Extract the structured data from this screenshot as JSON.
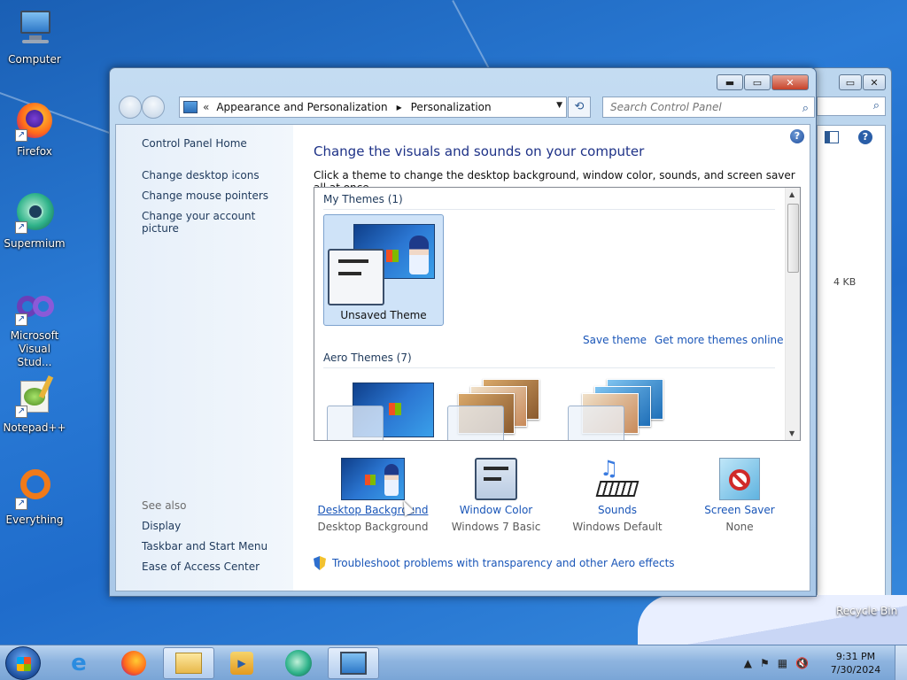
{
  "desktop": {
    "icons": [
      {
        "label": "Computer"
      },
      {
        "label": "Firefox"
      },
      {
        "label": "Supermium"
      },
      {
        "label": "Microsoft Visual Stud..."
      },
      {
        "label": "Notepad++"
      },
      {
        "label": "Everything"
      }
    ],
    "recycle_label": "Recycle Bin",
    "background_window_size": "4 KB"
  },
  "window": {
    "breadcrumb_prefix": "«",
    "breadcrumb": [
      "Appearance and Personalization",
      "Personalization"
    ],
    "search_placeholder": "Search Control Panel",
    "left_pane": {
      "home": "Control Panel Home",
      "links": [
        "Change desktop icons",
        "Change mouse pointers",
        "Change your account picture"
      ],
      "see_also_heading": "See also",
      "see_also": [
        "Display",
        "Taskbar and Start Menu",
        "Ease of Access Center"
      ]
    },
    "title": "Change the visuals and sounds on your computer",
    "subtitle": "Click a theme to change the desktop background, window color, sounds, and screen saver all at once.",
    "my_themes_heading": "My Themes (1)",
    "unsaved_theme_label": "Unsaved Theme",
    "save_theme": "Save theme",
    "get_more_themes": "Get more themes online",
    "aero_themes_heading": "Aero Themes (7)",
    "bottom": [
      {
        "label": "Desktop Background",
        "value": "Desktop Background",
        "icon": "wallpaper-icon"
      },
      {
        "label": "Window Color",
        "value": "Windows 7 Basic",
        "icon": "window-color-icon"
      },
      {
        "label": "Sounds",
        "value": "Windows Default",
        "icon": "sounds-icon"
      },
      {
        "label": "Screen Saver",
        "value": "None",
        "icon": "screen-saver-icon"
      }
    ],
    "troubleshoot": "Troubleshoot problems with transparency and other Aero effects"
  },
  "taskbar": {
    "time": "9:31 PM",
    "date": "7/30/2024"
  },
  "colors": {
    "accent_link": "#1a56b8",
    "title_blue": "#1e3287",
    "selection": "#cfe3f8"
  }
}
